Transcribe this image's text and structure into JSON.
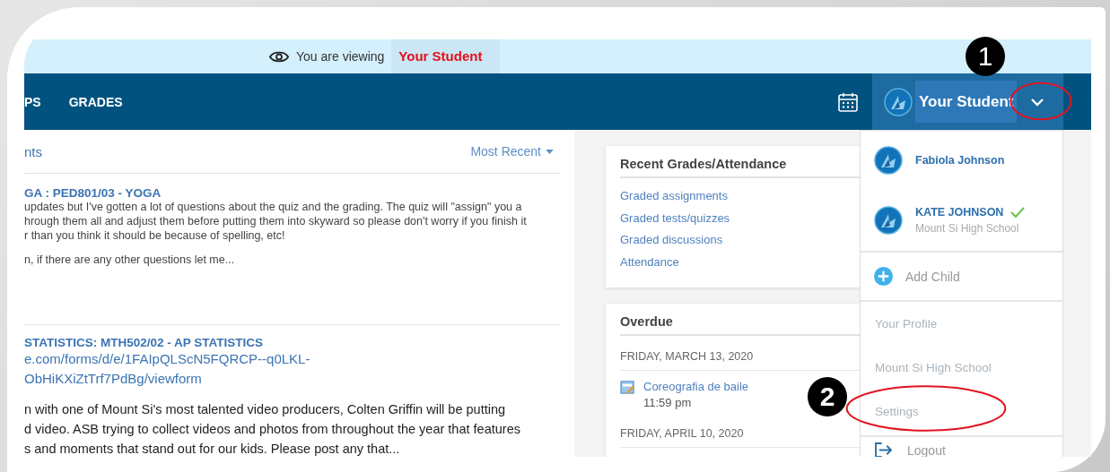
{
  "banner": {
    "prefix": "You are viewing",
    "student": "Your Student"
  },
  "nav": {
    "tabs": [
      "PS",
      "GRADES"
    ],
    "account": "Your Student"
  },
  "feed": {
    "title": "nts",
    "sort": "Most Recent",
    "posts": [
      {
        "title": "GA : PED801/03 - YOGA",
        "kind": "note",
        "paragraphs": [
          [
            "updates but I've gotten a lot of questions about the quiz and the grading. The quiz will \"assign\" you a",
            "hrough them all and adjust them before putting them into skyward so please don't worry if you finish it",
            "r than you think it should be because of spelling, etc!"
          ],
          [
            "n, if there are any other questions let me..."
          ]
        ]
      },
      {
        "title": "STATISTICS: MTH502/02 - AP STATISTICS",
        "kind": "link",
        "links": [
          "e.com/forms/d/e/1FAIpQLScN5FQRCP--q0LKL-",
          "ObHiKXiZtTrf7PdBg/viewform"
        ],
        "paragraphs": [
          [
            "n with one of Mount Si's most talented video producers, Colten Griffin will be putting",
            "d video.  ASB trying to collect videos and photos from throughout the year that features",
            "s and moments that stand out for our kids.  Please post any that..."
          ]
        ]
      }
    ]
  },
  "grades_card": {
    "title": "Recent Grades/Attendance",
    "links": [
      "Graded assignments",
      "Graded tests/quizzes",
      "Graded discussions",
      "Attendance"
    ]
  },
  "overdue": {
    "title": "Overdue",
    "groups": [
      {
        "date": "FRIDAY, MARCH 13, 2020",
        "items": [
          {
            "title": "Coreografia de baile",
            "time": "11:59 pm"
          }
        ]
      },
      {
        "date": "FRIDAY, APRIL 10, 2020"
      }
    ]
  },
  "menu": {
    "students": [
      {
        "name": "Fabiola Johnson",
        "selected": false
      },
      {
        "name": "KATE JOHNSON",
        "school": "Mount Si High School",
        "selected": true
      }
    ],
    "add": "Add Child",
    "links": [
      "Your Profile",
      "Mount Si High School",
      "Settings"
    ],
    "logout": "Logout"
  },
  "annotations": [
    {
      "label": "1"
    },
    {
      "label": "2"
    }
  ]
}
